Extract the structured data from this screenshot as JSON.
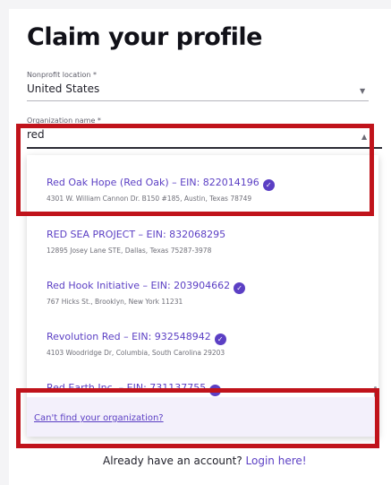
{
  "page": {
    "title": "Claim your profile"
  },
  "location_field": {
    "label": "Nonprofit location *",
    "value": "United States",
    "caret": "▼"
  },
  "org_field": {
    "label": "Organization name *",
    "value": "red",
    "caret": "▲"
  },
  "results": [
    {
      "name": "Red Oak Hope (Red Oak) – EIN: 822014196",
      "address": "4301 W. William Cannon Dr. B150 #185, Austin, Texas 78749"
    },
    {
      "name": "RED SEA PROJECT – EIN: 832068295",
      "address": "12895 Josey Lane STE, Dallas, Texas 75287-3978"
    },
    {
      "name": "Red Hook Initiative – EIN: 203904662",
      "address": "767 Hicks St., Brooklyn, New York 11231"
    },
    {
      "name": "Revolution Red – EIN: 932548942",
      "address": "4103 Woodridge Dr, Columbia, South Carolina 29203"
    },
    {
      "name": "Red Earth Inc. – EIN: 731137755",
      "address": ""
    }
  ],
  "verified_icon": "✓",
  "cant_find": {
    "link_text": "Can't find your organization?"
  },
  "footer": {
    "prompt": "Already have an account?",
    "link": "Login here!"
  },
  "colors": {
    "accent": "#5b3fc4",
    "highlight": "#c0131b"
  }
}
